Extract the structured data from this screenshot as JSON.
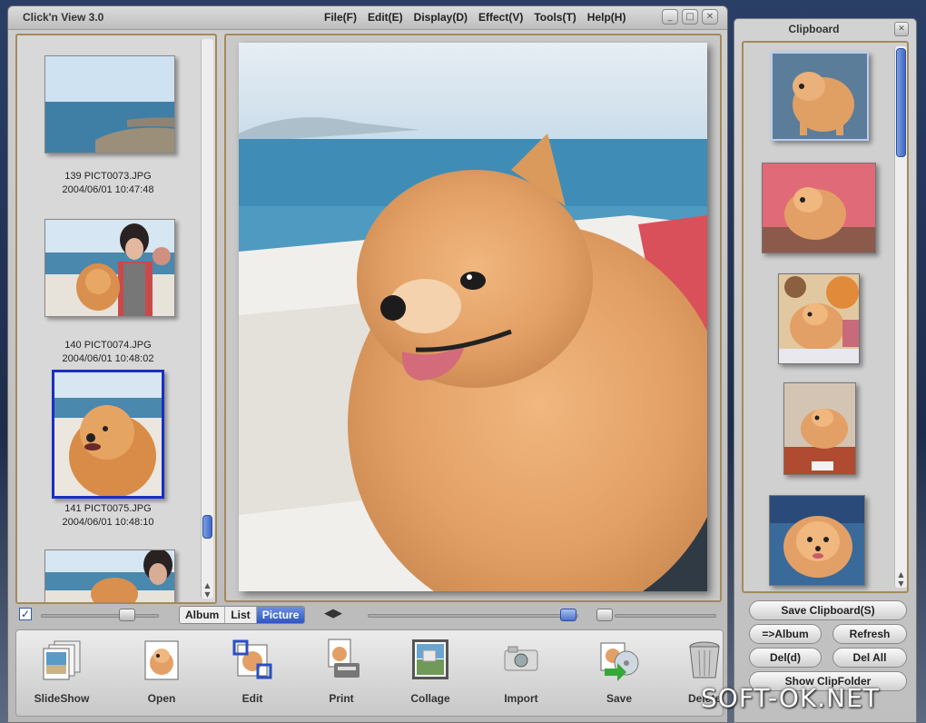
{
  "app": {
    "title": "Click'n View 3.0"
  },
  "menu": [
    {
      "label": "File(F)"
    },
    {
      "label": "Edit(E)"
    },
    {
      "label": "Display(D)"
    },
    {
      "label": "Effect(V)"
    },
    {
      "label": "Tools(T)"
    },
    {
      "label": "Help(H)"
    }
  ],
  "thumbnails": [
    {
      "caption_line1": "139 PICT0073.JPG",
      "caption_line2": "2004/06/01 10:47:48"
    },
    {
      "caption_line1": "140 PICT0074.JPG",
      "caption_line2": "2004/06/01 10:48:02"
    },
    {
      "caption_line1": "141 PICT0075.JPG",
      "caption_line2": "2004/06/01 10:48:10",
      "selected": true
    },
    {
      "caption_line1": "",
      "caption_line2": ""
    }
  ],
  "view_tabs": [
    {
      "label": "Album"
    },
    {
      "label": "List"
    },
    {
      "label": "Picture",
      "active": true
    }
  ],
  "toolbar": [
    {
      "label": "SlideShow",
      "icon": "slideshow-icon"
    },
    {
      "label": "Open",
      "icon": "open-icon"
    },
    {
      "label": "Edit",
      "icon": "edit-icon"
    },
    {
      "label": "Print",
      "icon": "print-icon"
    },
    {
      "label": "Collage",
      "icon": "collage-icon"
    },
    {
      "label": "Import",
      "icon": "camera-icon"
    },
    {
      "label": "Save",
      "icon": "save-icon"
    },
    {
      "label": "Delete",
      "icon": "trash-icon"
    }
  ],
  "clipboard": {
    "title": "Clipboard",
    "buttons": {
      "save": "Save Clipboard(S)",
      "album": "=>Album",
      "refresh": "Refresh",
      "del": "Del(d)",
      "del_all": "Del All",
      "show_folder": "Show ClipFolder"
    }
  },
  "watermark": "SOFT-OK.NET",
  "colors": {
    "frame": "#a48a5a",
    "selection": "#1a2fc2",
    "accent": "#3f67c5"
  }
}
